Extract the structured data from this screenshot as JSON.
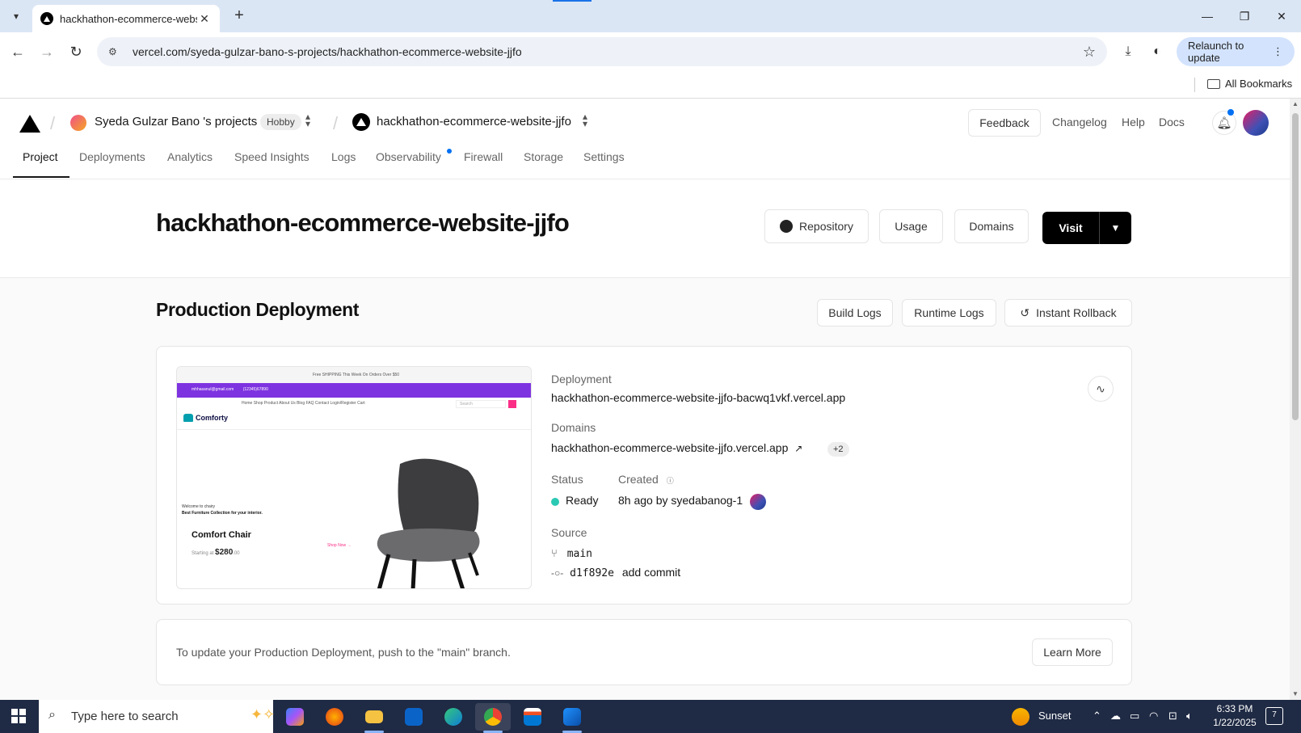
{
  "browser": {
    "tab_title": "hackhathon-ecommerce-websit",
    "url": "vercel.com/syeda-gulzar-bano-s-projects/hackhathon-ecommerce-website-jjfo",
    "relaunch_label": "Relaunch to update",
    "bookmarks_label": "All Bookmarks"
  },
  "header": {
    "team_name": "Syeda Gulzar Bano 's projects",
    "plan_badge": "Hobby",
    "project_name": "hackhathon-ecommerce-website-jjfo",
    "feedback_label": "Feedback",
    "links": [
      "Changelog",
      "Help",
      "Docs"
    ]
  },
  "tabs": [
    "Project",
    "Deployments",
    "Analytics",
    "Speed Insights",
    "Logs",
    "Observability",
    "Firewall",
    "Storage",
    "Settings"
  ],
  "hero": {
    "title": "hackhathon-ecommerce-website-jjfo",
    "repository_label": "Repository",
    "usage_label": "Usage",
    "domains_label": "Domains",
    "visit_label": "Visit"
  },
  "production": {
    "title": "Production Deployment",
    "build_logs_label": "Build Logs",
    "runtime_logs_label": "Runtime Logs",
    "rollback_label": "Instant Rollback",
    "deployment_label": "Deployment",
    "deployment_url": "hackhathon-ecommerce-website-jjfo-bacwq1vkf.vercel.app",
    "domains_label": "Domains",
    "domain_url": "hackhathon-ecommerce-website-jjfo.vercel.app",
    "domains_more": "+2",
    "status_label": "Status",
    "status_value": "Ready",
    "created_label": "Created",
    "created_value": "8h ago by syedabanog-1",
    "source_label": "Source",
    "branch": "main",
    "commit_hash": "d1f892e",
    "commit_message": "add commit",
    "status_color": "#2bc9b4"
  },
  "preview": {
    "free_shipping": "Free SHIPPING This Week On Orders Over $50",
    "email": "mhhasanul@gmail.com",
    "phone": "(12345)67890",
    "nav": "Home   Shop   Product   About Us   Blog   FAQ   Contact   Login/Register   Cart",
    "search": "Search",
    "brand": "Comforty",
    "welcome": "Welcome to chairy",
    "best": "Best Furniture Collection for your interior.",
    "heading": "Comfort Chair",
    "price_prefix": "Starting at",
    "price": "$280",
    "price_cents": ".00",
    "shop_now": "Shop Now →"
  },
  "update_notice": {
    "message": "To update your Production Deployment, push to the \"main\" branch.",
    "learn_more_label": "Learn More"
  },
  "taskbar": {
    "search_placeholder": "Type here to search",
    "weather": "Sunset",
    "time": "6:33 PM",
    "date": "1/22/2025",
    "notification_count": "7"
  }
}
